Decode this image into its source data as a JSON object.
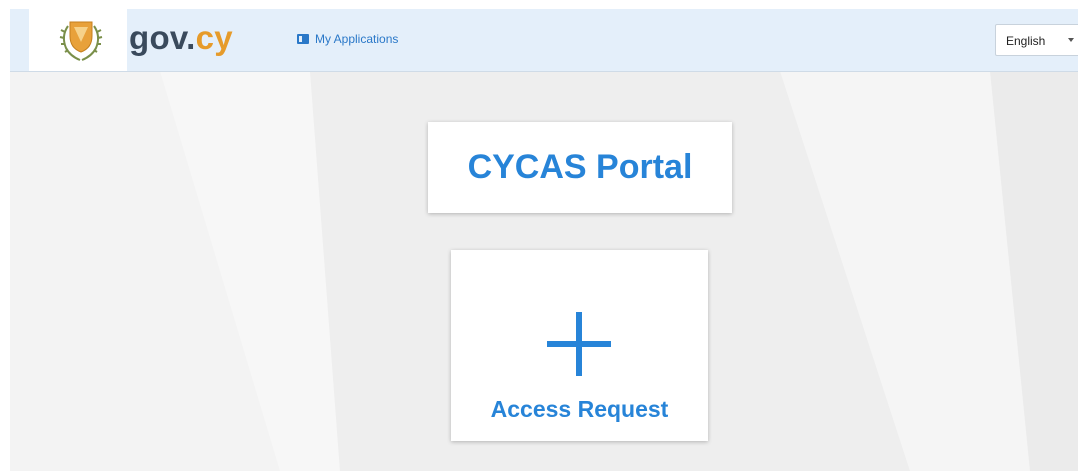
{
  "header": {
    "brand_part1": "gov.",
    "brand_part2": "cy",
    "emblem_icon": "cyprus-coat-of-arms-icon",
    "nav": {
      "my_applications_label": "My Applications",
      "icon": "window-icon"
    },
    "language": {
      "selected": "English",
      "caret_icon": "caret-down-icon"
    }
  },
  "main": {
    "portal_title": "CYCAS Portal",
    "access_request": {
      "label": "Access Request",
      "icon": "plus-icon"
    }
  },
  "colors": {
    "header_bg": "#e4effa",
    "accent_blue": "#2784d8",
    "brand_dark": "#3a4a5c",
    "brand_orange": "#e69b2a",
    "page_bg": "#f3f3f3"
  }
}
